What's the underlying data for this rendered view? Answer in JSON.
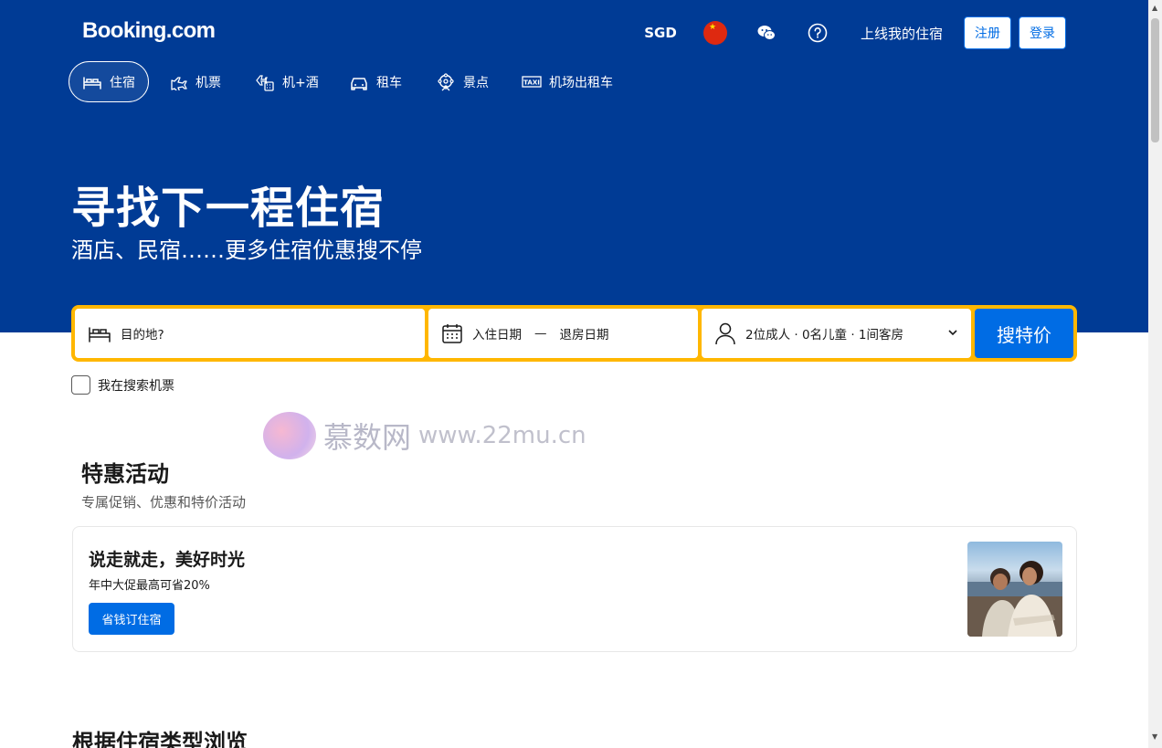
{
  "brand": {
    "name": "Booking.com"
  },
  "header": {
    "currency": "SGD",
    "flag_label": "★",
    "list_property": "上线我的住宿",
    "register": "注册",
    "login": "登录"
  },
  "nav": {
    "items": [
      {
        "label": "住宿",
        "icon": "bed-icon",
        "active": true
      },
      {
        "label": "机票",
        "icon": "plane-icon"
      },
      {
        "label": "机+酒",
        "icon": "flight-hotel-icon"
      },
      {
        "label": "租车",
        "icon": "car-icon"
      },
      {
        "label": "景点",
        "icon": "attractions-icon"
      },
      {
        "label": "机场出租车",
        "icon": "taxi-icon"
      }
    ]
  },
  "hero": {
    "title": "寻找下一程住宿",
    "subtitle": "酒店、民宿……更多住宿优惠搜不停"
  },
  "search": {
    "destination_placeholder": "目的地?",
    "checkin": "入住日期",
    "date_separator": "—",
    "checkout": "退房日期",
    "occupancy": "2位成人 · 0名儿童 · 1间客房",
    "button": "搜特价"
  },
  "flight_checkbox": {
    "label": "我在搜索机票",
    "checked": false
  },
  "watermark": {
    "name": "慕数网",
    "url": "www.22mu.cn"
  },
  "deals": {
    "title": "特惠活动",
    "subtitle": "专属促销、优惠和特价活动",
    "card": {
      "title": "说走就走，美好时光",
      "subtitle": "年中大促最高可省20%",
      "button": "省钱订住宿"
    }
  },
  "browse": {
    "title": "根据住宿类型浏览"
  },
  "colors": {
    "brand_blue": "#003b95",
    "accent_blue": "#006ce4",
    "search_border": "#ffb700"
  }
}
